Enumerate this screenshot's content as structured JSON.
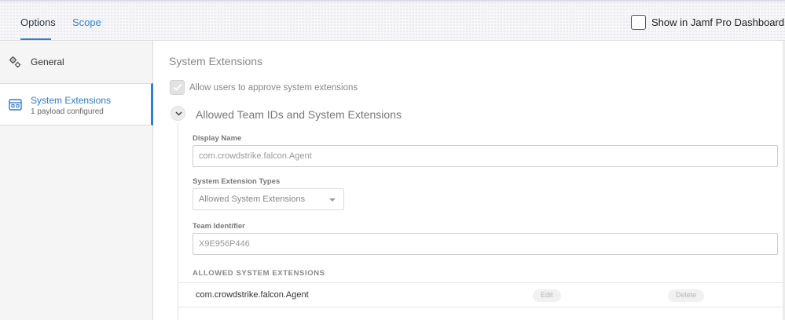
{
  "header": {
    "tabs": [
      {
        "label": "Options",
        "active": true
      },
      {
        "label": "Scope",
        "active": false
      }
    ],
    "dashboard_checkbox": {
      "label": "Show in Jamf Pro Dashboard",
      "checked": false
    }
  },
  "sidebar": {
    "items": [
      {
        "label": "General",
        "icon": "gears-icon",
        "active": false
      },
      {
        "label": "System Extensions",
        "sublabel": "1 payload configured",
        "icon": "system-extensions-icon",
        "active": true
      }
    ]
  },
  "main": {
    "section_title": "System Extensions",
    "allow_users_checkbox": {
      "label": "Allow users to approve system extensions",
      "checked": true,
      "disabled": true
    },
    "group": {
      "title": "Allowed Team IDs and System Extensions",
      "expanded": true,
      "display_name": {
        "label": "Display Name",
        "value": "com.crowdstrike.falcon.Agent"
      },
      "extension_types": {
        "label": "System Extension Types",
        "value": "Allowed System Extensions"
      },
      "team_identifier": {
        "label": "Team Identifier",
        "value": "X9E956P446"
      },
      "allowed_list": {
        "heading": "ALLOWED SYSTEM EXTENSIONS",
        "rows": [
          {
            "name": "com.crowdstrike.falcon.Agent",
            "edit_label": "Edit",
            "delete_label": "Delete"
          }
        ]
      }
    }
  },
  "colors": {
    "accent": "#2a7fd6",
    "link": "#3b86c8"
  }
}
